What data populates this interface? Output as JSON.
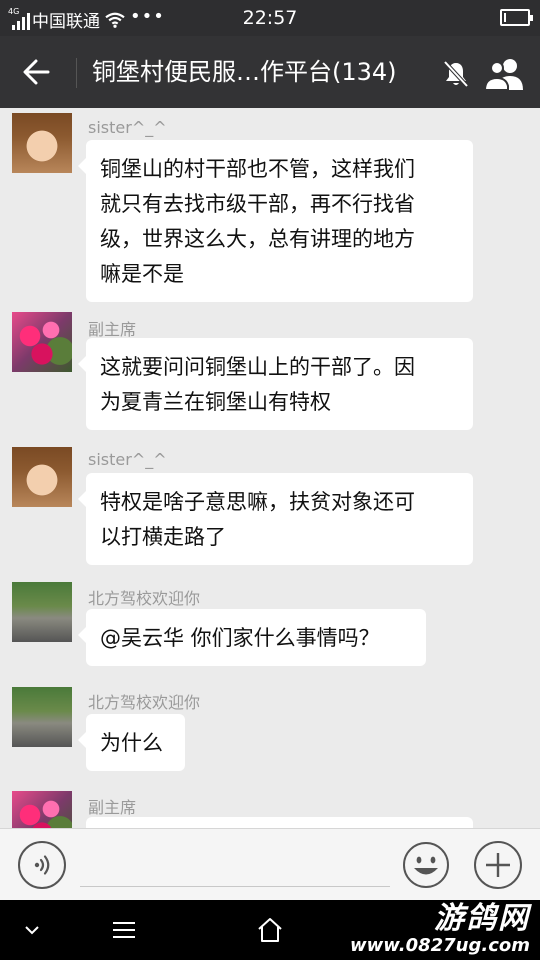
{
  "status_bar": {
    "network": "4G",
    "carrier": "中国联通",
    "dots": "•••",
    "time": "22:57",
    "battery_level": 0.1
  },
  "header": {
    "title": "铜堡村便民服…作平台(134)",
    "icons": [
      "back-arrow-icon",
      "mute-icon",
      "group-members-icon"
    ]
  },
  "messages": [
    {
      "sender": "sister^_^",
      "avatar": "girl-avatar",
      "lines": [
        "铜堡山的村干部也不管，这样我们",
        "就只有去找市级干部，再不行找省",
        "级，世界这么大，总有讲理的地方",
        "嘛是不是"
      ]
    },
    {
      "sender": "副主席",
      "avatar": "flower-avatar",
      "lines": [
        "这就要问问铜堡山上的干部了。因",
        "为夏青兰在铜堡山有特权"
      ]
    },
    {
      "sender": "sister^_^",
      "avatar": "girl-avatar",
      "lines": [
        "特权是啥子意思嘛，扶贫对象还可",
        "以打横走路了"
      ]
    },
    {
      "sender": "北方驾校欢迎你",
      "avatar": "car-avatar",
      "lines": [
        "@吴云华 你们家什么事情吗？"
      ]
    },
    {
      "sender": "北方驾校欢迎你",
      "avatar": "car-avatar",
      "lines": [
        "为什么"
      ]
    },
    {
      "sender": "副主席",
      "avatar": "flower-avatar",
      "lines": [
        ""
      ]
    }
  ],
  "input_bar": {
    "placeholder": "",
    "icons": [
      "voice-icon",
      "emoji-icon",
      "plus-icon"
    ]
  },
  "nav_bar": {
    "icons": [
      "chevron-down-icon",
      "menu-icon",
      "home-icon"
    ]
  },
  "watermark": {
    "brand": "游鸽网",
    "url": "www.0827ug.com"
  },
  "colors": {
    "status_bar_bg": "#2e2e30",
    "header_bg": "#333335",
    "chat_bg": "#ebebeb",
    "bubble_bg": "#ffffff",
    "sender_text": "#9a9a9a"
  }
}
